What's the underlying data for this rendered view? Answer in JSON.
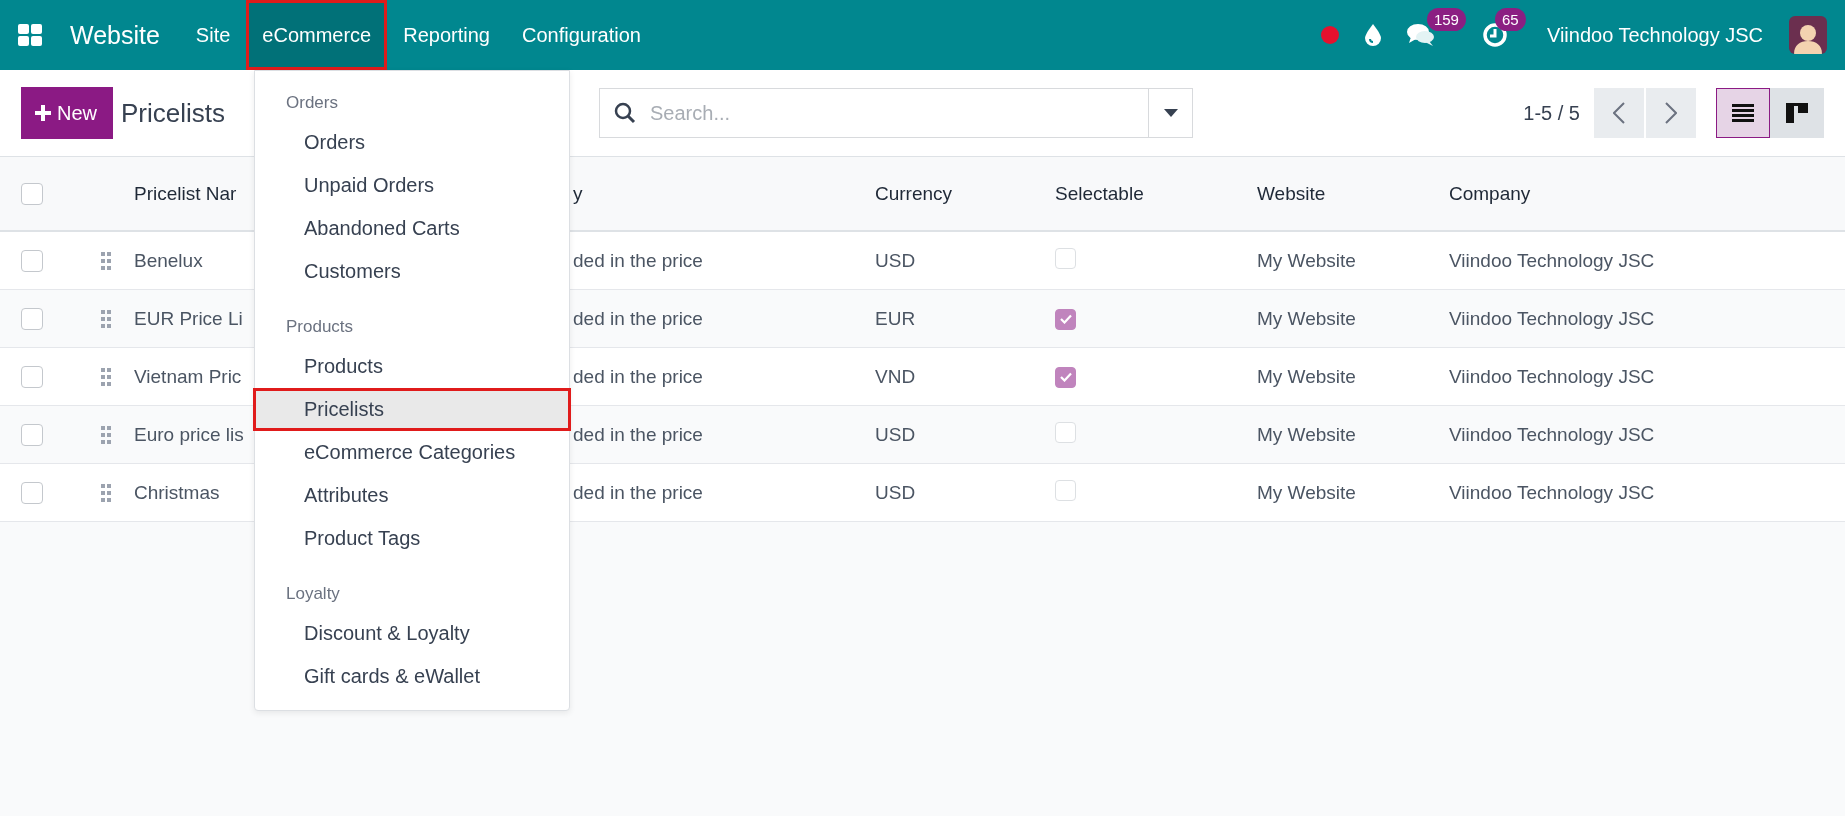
{
  "navbar": {
    "app_name": "Website",
    "menus": [
      {
        "label": "Site",
        "selected": false
      },
      {
        "label": "eCommerce",
        "selected": true
      },
      {
        "label": "Reporting",
        "selected": false
      },
      {
        "label": "Configuration",
        "selected": false
      }
    ],
    "chat_count": "159",
    "activity_count": "65",
    "company": "Viindoo Technology JSC"
  },
  "control_panel": {
    "new_button": "New",
    "title": "Pricelists",
    "search": {
      "placeholder": "Search..."
    },
    "pager": "1-5 / 5",
    "views": [
      {
        "kind": "list",
        "selected": true
      },
      {
        "kind": "kanban",
        "selected": false
      }
    ]
  },
  "table": {
    "select_all_checked": false,
    "columns": [
      "Pricelist Nar",
      "y",
      "Currency",
      "Selectable",
      "Website",
      "Company"
    ],
    "rows": [
      {
        "checked": false,
        "name": "Benelux",
        "column_2": "ded in the price",
        "currency": "USD",
        "selectable": false,
        "website": "My Website",
        "company": "Viindoo Technology JSC"
      },
      {
        "checked": false,
        "name": "EUR Price Li",
        "column_2": "ded in the price",
        "currency": "EUR",
        "selectable": true,
        "website": "My Website",
        "company": "Viindoo Technology JSC"
      },
      {
        "checked": false,
        "name": "Vietnam Pric",
        "column_2": "ded in the price",
        "currency": "VND",
        "selectable": true,
        "website": "My Website",
        "company": "Viindoo Technology JSC"
      },
      {
        "checked": false,
        "name": "Euro price lis",
        "column_2": "ded in the price",
        "currency": "USD",
        "selectable": false,
        "website": "My Website",
        "company": "Viindoo Technology JSC"
      },
      {
        "checked": false,
        "name": "Christmas",
        "column_2": "ded in the price",
        "currency": "USD",
        "selectable": false,
        "website": "My Website",
        "company": "Viindoo Technology JSC"
      }
    ]
  },
  "dropdown": {
    "sections": [
      {
        "title": "Orders",
        "items": [
          {
            "label": "Orders",
            "selected": false
          },
          {
            "label": "Unpaid Orders",
            "selected": false
          },
          {
            "label": "Abandoned Carts",
            "selected": false
          },
          {
            "label": "Customers",
            "selected": false
          }
        ]
      },
      {
        "title": "Products",
        "items": [
          {
            "label": "Products",
            "selected": false
          },
          {
            "label": "Pricelists",
            "selected": true
          },
          {
            "label": "eCommerce Categories",
            "selected": false
          },
          {
            "label": "Attributes",
            "selected": false
          },
          {
            "label": "Product Tags",
            "selected": false
          }
        ]
      },
      {
        "title": "Loyalty",
        "items": [
          {
            "label": "Discount & Loyalty",
            "selected": false
          },
          {
            "label": "Gift cards & eWallet",
            "selected": false
          }
        ]
      }
    ]
  }
}
